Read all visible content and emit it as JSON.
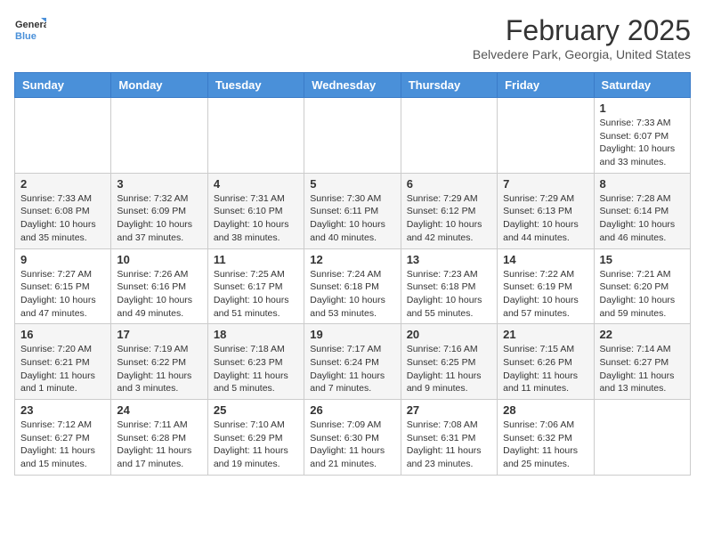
{
  "logo": {
    "line1": "General",
    "line2": "Blue"
  },
  "title": "February 2025",
  "subtitle": "Belvedere Park, Georgia, United States",
  "days_of_week": [
    "Sunday",
    "Monday",
    "Tuesday",
    "Wednesday",
    "Thursday",
    "Friday",
    "Saturday"
  ],
  "weeks": [
    [
      {
        "day": "",
        "info": ""
      },
      {
        "day": "",
        "info": ""
      },
      {
        "day": "",
        "info": ""
      },
      {
        "day": "",
        "info": ""
      },
      {
        "day": "",
        "info": ""
      },
      {
        "day": "",
        "info": ""
      },
      {
        "day": "1",
        "info": "Sunrise: 7:33 AM\nSunset: 6:07 PM\nDaylight: 10 hours and 33 minutes."
      }
    ],
    [
      {
        "day": "2",
        "info": "Sunrise: 7:33 AM\nSunset: 6:08 PM\nDaylight: 10 hours and 35 minutes."
      },
      {
        "day": "3",
        "info": "Sunrise: 7:32 AM\nSunset: 6:09 PM\nDaylight: 10 hours and 37 minutes."
      },
      {
        "day": "4",
        "info": "Sunrise: 7:31 AM\nSunset: 6:10 PM\nDaylight: 10 hours and 38 minutes."
      },
      {
        "day": "5",
        "info": "Sunrise: 7:30 AM\nSunset: 6:11 PM\nDaylight: 10 hours and 40 minutes."
      },
      {
        "day": "6",
        "info": "Sunrise: 7:29 AM\nSunset: 6:12 PM\nDaylight: 10 hours and 42 minutes."
      },
      {
        "day": "7",
        "info": "Sunrise: 7:29 AM\nSunset: 6:13 PM\nDaylight: 10 hours and 44 minutes."
      },
      {
        "day": "8",
        "info": "Sunrise: 7:28 AM\nSunset: 6:14 PM\nDaylight: 10 hours and 46 minutes."
      }
    ],
    [
      {
        "day": "9",
        "info": "Sunrise: 7:27 AM\nSunset: 6:15 PM\nDaylight: 10 hours and 47 minutes."
      },
      {
        "day": "10",
        "info": "Sunrise: 7:26 AM\nSunset: 6:16 PM\nDaylight: 10 hours and 49 minutes."
      },
      {
        "day": "11",
        "info": "Sunrise: 7:25 AM\nSunset: 6:17 PM\nDaylight: 10 hours and 51 minutes."
      },
      {
        "day": "12",
        "info": "Sunrise: 7:24 AM\nSunset: 6:18 PM\nDaylight: 10 hours and 53 minutes."
      },
      {
        "day": "13",
        "info": "Sunrise: 7:23 AM\nSunset: 6:18 PM\nDaylight: 10 hours and 55 minutes."
      },
      {
        "day": "14",
        "info": "Sunrise: 7:22 AM\nSunset: 6:19 PM\nDaylight: 10 hours and 57 minutes."
      },
      {
        "day": "15",
        "info": "Sunrise: 7:21 AM\nSunset: 6:20 PM\nDaylight: 10 hours and 59 minutes."
      }
    ],
    [
      {
        "day": "16",
        "info": "Sunrise: 7:20 AM\nSunset: 6:21 PM\nDaylight: 11 hours and 1 minute."
      },
      {
        "day": "17",
        "info": "Sunrise: 7:19 AM\nSunset: 6:22 PM\nDaylight: 11 hours and 3 minutes."
      },
      {
        "day": "18",
        "info": "Sunrise: 7:18 AM\nSunset: 6:23 PM\nDaylight: 11 hours and 5 minutes."
      },
      {
        "day": "19",
        "info": "Sunrise: 7:17 AM\nSunset: 6:24 PM\nDaylight: 11 hours and 7 minutes."
      },
      {
        "day": "20",
        "info": "Sunrise: 7:16 AM\nSunset: 6:25 PM\nDaylight: 11 hours and 9 minutes."
      },
      {
        "day": "21",
        "info": "Sunrise: 7:15 AM\nSunset: 6:26 PM\nDaylight: 11 hours and 11 minutes."
      },
      {
        "day": "22",
        "info": "Sunrise: 7:14 AM\nSunset: 6:27 PM\nDaylight: 11 hours and 13 minutes."
      }
    ],
    [
      {
        "day": "23",
        "info": "Sunrise: 7:12 AM\nSunset: 6:27 PM\nDaylight: 11 hours and 15 minutes."
      },
      {
        "day": "24",
        "info": "Sunrise: 7:11 AM\nSunset: 6:28 PM\nDaylight: 11 hours and 17 minutes."
      },
      {
        "day": "25",
        "info": "Sunrise: 7:10 AM\nSunset: 6:29 PM\nDaylight: 11 hours and 19 minutes."
      },
      {
        "day": "26",
        "info": "Sunrise: 7:09 AM\nSunset: 6:30 PM\nDaylight: 11 hours and 21 minutes."
      },
      {
        "day": "27",
        "info": "Sunrise: 7:08 AM\nSunset: 6:31 PM\nDaylight: 11 hours and 23 minutes."
      },
      {
        "day": "28",
        "info": "Sunrise: 7:06 AM\nSunset: 6:32 PM\nDaylight: 11 hours and 25 minutes."
      },
      {
        "day": "",
        "info": ""
      }
    ]
  ]
}
